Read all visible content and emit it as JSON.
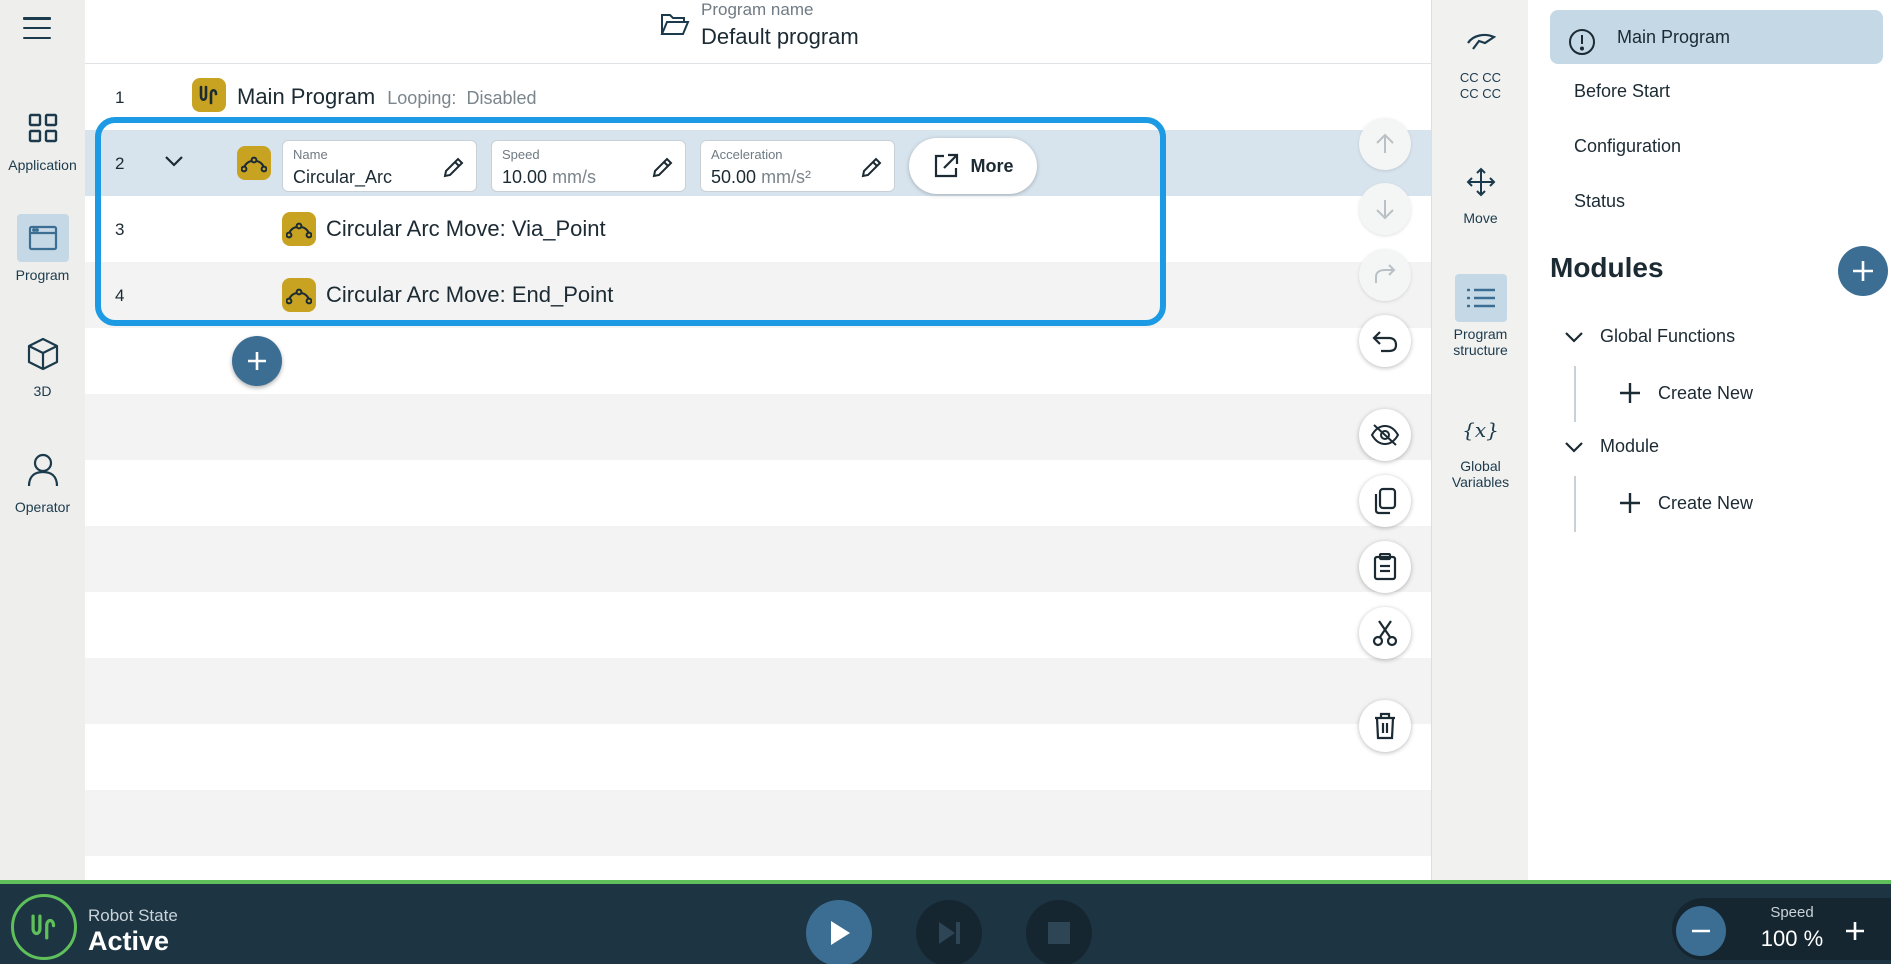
{
  "nav": {
    "menu_icon": "hamburger-icon",
    "items": [
      {
        "label": "Application",
        "icon": "grid-icon",
        "active": false
      },
      {
        "label": "Program",
        "icon": "window-icon",
        "active": true
      },
      {
        "label": "3D",
        "icon": "cube-icon",
        "active": false
      },
      {
        "label": "Operator",
        "icon": "person-icon",
        "active": false
      }
    ]
  },
  "header": {
    "program_label": "Program name",
    "program_name": "Default program",
    "icon": "folder-open-icon"
  },
  "program": {
    "row1": {
      "num": "1",
      "title": "Main Program",
      "looping_label": "Looping:",
      "looping_value": "Disabled"
    },
    "row2": {
      "num": "2",
      "name_label": "Name",
      "name_value": "Circular_Arc",
      "speed_label": "Speed",
      "speed_value": "10.00",
      "speed_unit": "mm/s",
      "accel_label": "Acceleration",
      "accel_value": "50.00",
      "accel_unit": "mm/s²",
      "more_label": "More"
    },
    "row3": {
      "num": "3",
      "label": "Circular Arc Move:",
      "value": "Via_Point"
    },
    "row4": {
      "num": "4",
      "label": "Circular Arc Move:",
      "value": "End_Point"
    }
  },
  "tools": {
    "items": [
      {
        "label": "CC CC\nCC CC",
        "icon": "tcp-icon",
        "active": false
      },
      {
        "label": "Move",
        "icon": "move-arrows-icon",
        "active": false
      },
      {
        "label": "Program\nstructure",
        "icon": "list-icon",
        "active": true
      },
      {
        "label": "Global\nVariables",
        "icon": "variable-icon",
        "active": false
      }
    ]
  },
  "rightpanel": {
    "items": [
      {
        "label": "Main Program",
        "selected": true
      },
      {
        "label": "Before Start",
        "selected": false
      },
      {
        "label": "Configuration",
        "selected": false
      },
      {
        "label": "Status",
        "selected": false
      }
    ],
    "modules_title": "Modules",
    "groups": [
      {
        "label": "Global Functions",
        "create_label": "Create New"
      },
      {
        "label": "Module",
        "create_label": "Create New"
      }
    ]
  },
  "status": {
    "robot_state_label": "Robot State",
    "robot_state_value": "Active",
    "speed_label": "Speed",
    "speed_value": "100 %"
  },
  "colors": {
    "accent": "#3c6e94",
    "highlight": "#1c9be4",
    "ur_gold": "#c8a322",
    "status_green": "#5fbf5a",
    "bottom_bar": "#1d3442"
  }
}
